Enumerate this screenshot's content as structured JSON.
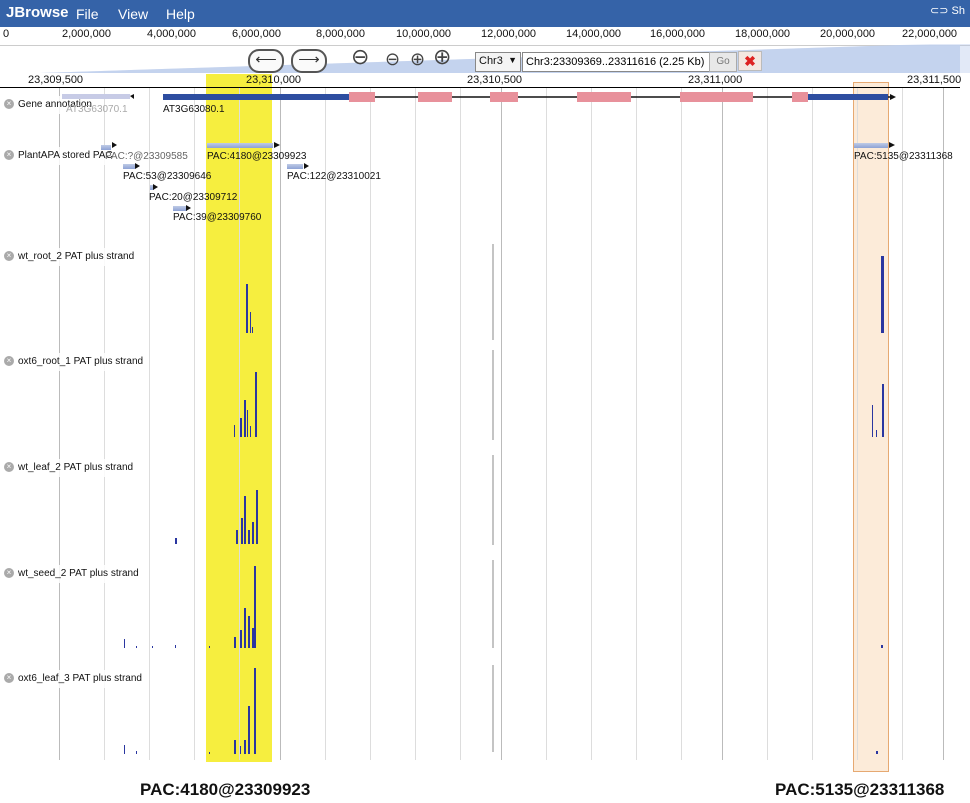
{
  "app": {
    "brand": "JBrowse",
    "menu": [
      "File",
      "View",
      "Help"
    ],
    "share_label": "Sh"
  },
  "overview": {
    "scale_labels": [
      "0",
      "2,000,000",
      "4,000,000",
      "6,000,000",
      "8,000,000",
      "10,000,000",
      "12,000,000",
      "14,000,000",
      "16,000,000",
      "18,000,000",
      "20,000,000",
      "22,000,000"
    ]
  },
  "nav": {
    "back_icon": "left-arrow-icon",
    "forward_icon": "right-arrow-icon",
    "zoom_icons": [
      "zoom-out-large-icon",
      "zoom-out-small-icon",
      "zoom-in-small-icon",
      "zoom-in-large-icon"
    ],
    "chromosome": "Chr3",
    "location": "Chr3:23309369..23311616 (2.25 Kb)",
    "go_label": "Go",
    "clear_icon": "close-x-icon"
  },
  "ruler": {
    "labels": [
      "23,309,500",
      "23,310,000",
      "23,310,500",
      "23,311,000",
      "23,311,500"
    ]
  },
  "tracks": {
    "gene": {
      "label": "Gene annotation",
      "gene1": "AT3G63070.1",
      "gene2": "AT3G63080.1"
    },
    "pac": {
      "label": "PlantAPA stored PAC",
      "features": [
        "PAC:?@23309585",
        "PAC:53@23309646",
        "PAC:20@23309712",
        "PAC:39@23309760",
        "PAC:4180@23309923",
        "PAC:122@23310021",
        "PAC:5135@23311368"
      ]
    },
    "signals": [
      {
        "label": "wt_root_2 PAT plus strand"
      },
      {
        "label": "oxt6_root_1 PAT plus strand"
      },
      {
        "label": "wt_leaf_2 PAT plus strand"
      },
      {
        "label": "wt_seed_2 PAT plus strand"
      },
      {
        "label": "oxt6_leaf_3 PAT plus strand"
      }
    ]
  },
  "captions": {
    "left": "PAC:4180@23309923",
    "right": "PAC:5135@23311368"
  },
  "colors": {
    "menubar": "#3563a8",
    "highlight_yellow": "#f6ee3f",
    "highlight_orange": "#fcebd9",
    "exon": "#e8919b",
    "utr": "#2d4da0",
    "signal": "#2a36a0"
  }
}
